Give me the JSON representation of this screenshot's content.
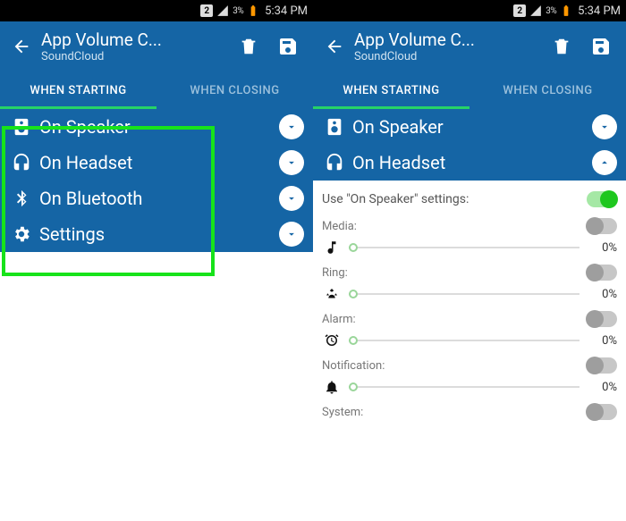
{
  "status": {
    "sim": "2",
    "battery": "3%",
    "time": "5:34 PM"
  },
  "appbar": {
    "title": "App Volume C...",
    "subtitle": "SoundCloud"
  },
  "tabs": {
    "starting": "WHEN STARTING",
    "closing": "WHEN CLOSING"
  },
  "options": {
    "speaker": "On Speaker",
    "headset": "On Headset",
    "bluetooth": "On Bluetooth",
    "settings": "Settings"
  },
  "panel": {
    "use_speaker_label": "Use \"On Speaker\" settings:",
    "media": {
      "label": "Media:",
      "percent": "0%"
    },
    "ring": {
      "label": "Ring:",
      "percent": "0%"
    },
    "alarm": {
      "label": "Alarm:",
      "percent": "0%"
    },
    "notification": {
      "label": "Notification:",
      "percent": "0%"
    },
    "system": {
      "label": "System:"
    }
  }
}
